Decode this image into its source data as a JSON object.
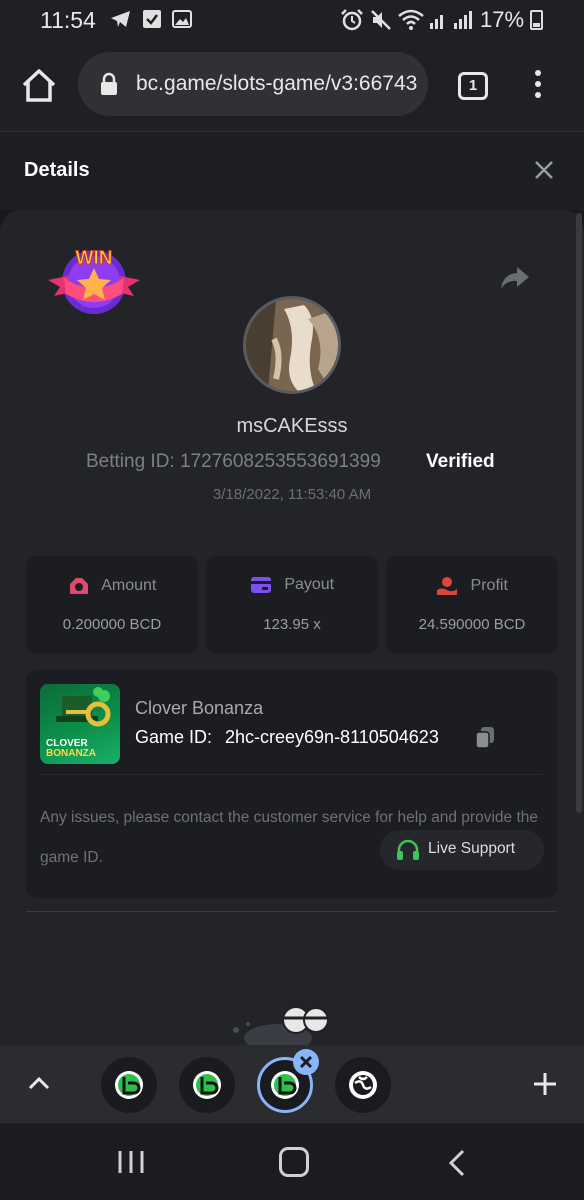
{
  "status_bar": {
    "time": "11:54",
    "battery": "17%",
    "left_icons": [
      "telegram-icon",
      "check-icon",
      "image-icon"
    ],
    "right_icons": [
      "alarm-icon",
      "mute-icon",
      "wifi-icon",
      "signal-icon"
    ]
  },
  "browser": {
    "url": "bc.game/slots-game/v3:66743",
    "tab_count": "1"
  },
  "details": {
    "title": "Details"
  },
  "bet": {
    "username": "msCAKEsss",
    "betting_id": "Betting ID: 1727608253553691399",
    "verified": "Verified",
    "time": "3/18/2022, 11:53:40 AM",
    "badge": "WIN"
  },
  "stats": [
    {
      "label": "Amount",
      "value": "0.200000 BCD",
      "icon": "amount-icon",
      "color": "#e24a6d"
    },
    {
      "label": "Payout",
      "value": "123.95 x",
      "icon": "payout-icon",
      "color": "#7b4ff0"
    },
    {
      "label": "Profit",
      "value": "24.590000 BCD",
      "icon": "profit-icon",
      "color": "#e0443b"
    }
  ],
  "game": {
    "name": "Clover Bonanza",
    "id_label": "Game ID:",
    "id_value": "2hc-creey69n-8110504623",
    "thumb_line1": "CLOVER",
    "thumb_line2": "BONANZA",
    "help_text": "Any issues, please contact the customer service for help and provide the game ID.",
    "support_label": "Live Support"
  },
  "colors": {
    "accent_green": "#3cc45a",
    "background": "#18191d",
    "card": "#232428"
  }
}
